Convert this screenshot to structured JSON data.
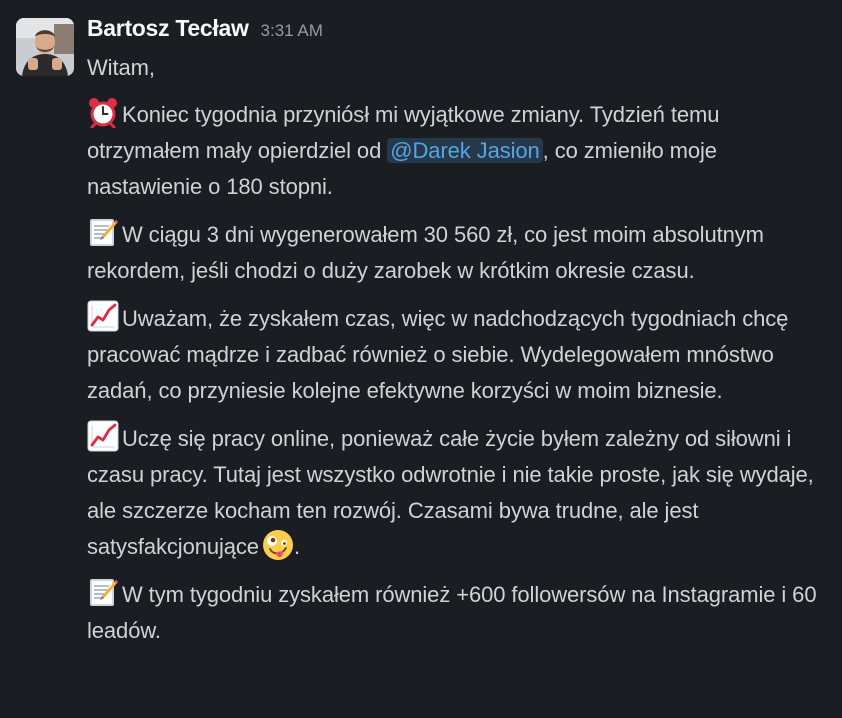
{
  "message": {
    "sender": "Bartosz Tecław",
    "timestamp": "3:31 AM",
    "greeting": "Witam,",
    "paragraphs": [
      {
        "icon": "alarm-clock-emoji",
        "before": "Koniec tygodnia przyniósł mi wyjątkowe zmiany. Tydzień temu otrzymałem mały opierdziel od ",
        "mention": "@Darek Jasion",
        "after": ", co zmieniło moje nastawienie o 180 stopni."
      },
      {
        "icon": "memo-emoji",
        "text": "W ciągu 3 dni wygenerowałem 30 560 zł, co jest moim absolutnym rekordem, jeśli chodzi o duży zarobek w krótkim okresie czasu."
      },
      {
        "icon": "chart-increasing-emoji",
        "text": "Uważam, że zyskałem czas, więc w nadchodzących tygodniach chcę pracować mądrze i zadbać również o siebie. Wydelegowałem mnóstwo zadań, co przyniesie kolejne efektywne korzyści w moim biznesie."
      },
      {
        "icon": "chart-increasing-emoji",
        "text": "Uczę się pracy online, ponieważ całe życie byłem zależny od siłowni i czasu pracy. Tutaj jest wszystko odwrotnie i nie takie proste, jak się wydaje, ale szczerze kocham ten rozwój. Czasami bywa trudne, ale jest satysfakcjonujące",
        "trailing_emoji": "zany-face-emoji",
        "after": "."
      },
      {
        "icon": "memo-emoji",
        "text": "W tym tygodniu zyskałem również +600 followersów na Instagramie i 60 leadów."
      }
    ]
  },
  "colors": {
    "background": "#1a1d21",
    "text": "#d1d2d3",
    "sender": "#f8f8f8",
    "timestamp": "#9a9b9e",
    "mention_text": "#52a7e2",
    "mention_bg": "#27384a"
  }
}
